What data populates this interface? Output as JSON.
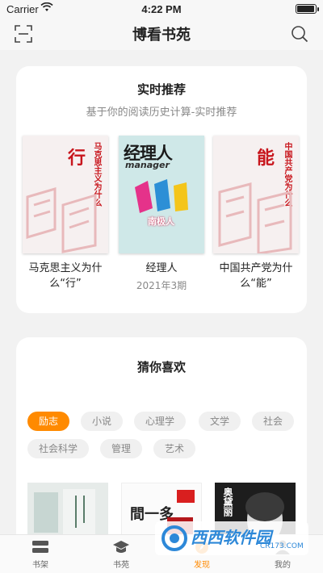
{
  "status": {
    "carrier": "Carrier",
    "time": "4:22 PM",
    "battery_level": 0.95
  },
  "nav": {
    "title": "博看书苑"
  },
  "recommend": {
    "title": "实时推荐",
    "subtitle": "基于你的阅读历史计算-实时推荐",
    "books": [
      {
        "name": "马克思主义为什么“行”",
        "issue": "",
        "cover": {
          "big": "行",
          "vertical": "马克思主义为什么"
        }
      },
      {
        "name": "经理人",
        "issue": "2021年3期",
        "cover": {
          "title": "经理人",
          "sub": "manager",
          "caption": "南极人"
        }
      },
      {
        "name": "中国共产党为什么“能”",
        "issue": "",
        "cover": {
          "big": "能",
          "vertical": "中国共产党为什么"
        }
      }
    ]
  },
  "guess": {
    "title": "猜你喜欢",
    "tags": [
      "励志",
      "小说",
      "心理学",
      "文学",
      "社会",
      "社会科学",
      "管理",
      "艺术"
    ],
    "active_tag": "励志",
    "mini_books": [
      {
        "text": ""
      },
      {
        "text": "間一多"
      },
      {
        "text": "奥黛丽"
      }
    ]
  },
  "tabs": [
    {
      "label": "书架",
      "icon": "bookshelf-icon"
    },
    {
      "label": "书苑",
      "icon": "graduation-cap-icon"
    },
    {
      "label": "发现",
      "icon": "discover-icon"
    },
    {
      "label": "我的",
      "icon": "user-icon"
    }
  ],
  "active_tab": "发现",
  "watermark": {
    "text": "西西软件园",
    "url": "CR173.COM"
  },
  "colors": {
    "accent": "#ff8a00",
    "cover_red": "#c8161d",
    "watermark_blue": "#2d88d8"
  }
}
